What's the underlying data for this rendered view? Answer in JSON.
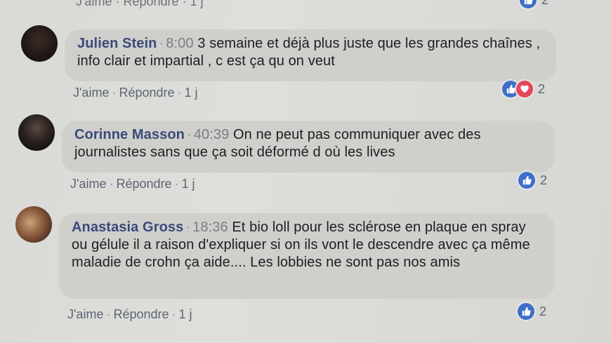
{
  "top_partial": {
    "like": "J'aime",
    "reply": "Répondre",
    "age": "1 j",
    "reaction_count": "2"
  },
  "comments": [
    {
      "author": "Julien Stein",
      "time": "8:00",
      "text": "3 semaine et déjà plus juste que les grandes chaînes , info clair et impartial , c est ça qu on veut",
      "like": "J'aime",
      "reply": "Répondre",
      "age": "1 j",
      "reaction_count": "2",
      "reactions": [
        "like-icon",
        "love-icon"
      ]
    },
    {
      "author": "Corinne Masson",
      "time": "40:39",
      "text": "On ne peut pas communiquer avec des journalistes sans que ça soit déformé d où les lives",
      "like": "J'aime",
      "reply": "Répondre",
      "age": "1 j",
      "reaction_count": "2",
      "reactions": [
        "like-icon"
      ]
    },
    {
      "author": "Anastasia Gross",
      "time": "18:36",
      "text": "Et bio loll pour les sclérose en plaque en spray ou gélule il a raison d'expliquer si on ils vont le descendre avec ça même maladie de crohn ça aide.... Les lobbies ne sont pas nos amis",
      "like": "J'aime",
      "reply": "Répondre",
      "age": "1 j",
      "reaction_count": "2",
      "reactions": [
        "like-icon"
      ]
    }
  ],
  "colors": {
    "author": "#3b4a78",
    "like_badge": "#3f6fc8",
    "love_badge": "#e5485b",
    "bubble": "#cfcfcc"
  }
}
